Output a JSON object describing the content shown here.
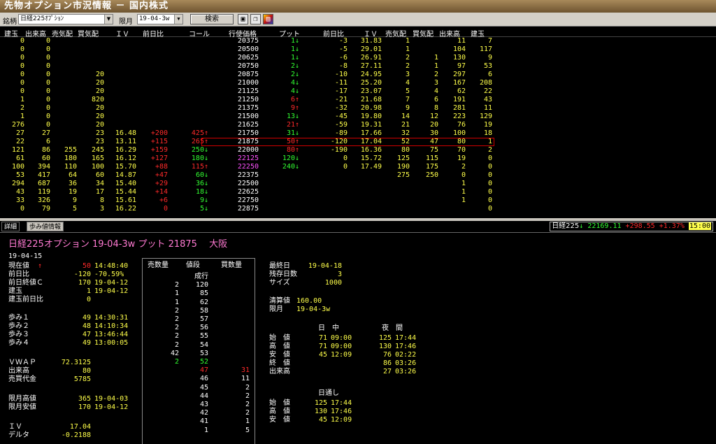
{
  "window": {
    "title": "先物オプション市況情報 － 国内株式"
  },
  "toolbar": {
    "brand_label": "銘柄",
    "brand_value": "日経225ｵﾌﾟｼｮﾝ",
    "month_label": "限月",
    "month_value": "19-04-3w",
    "search_label": "検索",
    "icons": [
      "save-icon",
      "copy-icon",
      "chart-icon"
    ]
  },
  "headers": {
    "call_oi": "建玉",
    "call_vol": "出来高",
    "call_bq": "売気配",
    "call_aq": "買気配",
    "call_iv": "ＩＶ",
    "call_chg": "前日比",
    "call_px": "コール",
    "strike": "行使価格",
    "put_px": "プット",
    "put_chg": "前日比",
    "put_iv": "ＩＶ",
    "put_bq": "売気配",
    "put_aq": "買気配",
    "put_vol": "出来高",
    "put_oi": "建玉"
  },
  "colors": {
    "bg": "#000000",
    "strike": "#ffffff",
    "atm_strike": "#ff52ff",
    "up": "#ff2a2a",
    "down": "#32ff32",
    "value": "#ffff4a",
    "highlight_border": "#d00000"
  },
  "selected_strike": "21875",
  "board": [
    {
      "c_oi": "0",
      "c_vol": "0",
      "c_bq": "",
      "c_aq": "",
      "c_iv": "",
      "c_chg": "",
      "c_px": "",
      "k": "20375",
      "p_px": "1↓",
      "p_chg": "-3",
      "p_iv": "31.83",
      "p_bq": "1",
      "p_aq": "",
      "p_vol": "11",
      "p_oi": "7"
    },
    {
      "c_oi": "0",
      "c_vol": "0",
      "c_bq": "",
      "c_aq": "",
      "c_iv": "",
      "c_chg": "",
      "c_px": "",
      "k": "20500",
      "p_px": "1↓",
      "p_chg": "-5",
      "p_iv": "29.01",
      "p_bq": "1",
      "p_aq": "",
      "p_vol": "104",
      "p_oi": "117"
    },
    {
      "c_oi": "0",
      "c_vol": "0",
      "c_bq": "",
      "c_aq": "",
      "c_iv": "",
      "c_chg": "",
      "c_px": "",
      "k": "20625",
      "p_px": "1↓",
      "p_chg": "-6",
      "p_iv": "26.91",
      "p_bq": "2",
      "p_aq": "1",
      "p_vol": "130",
      "p_oi": "9"
    },
    {
      "c_oi": "0",
      "c_vol": "0",
      "c_bq": "",
      "c_aq": "",
      "c_iv": "",
      "c_chg": "",
      "c_px": "",
      "k": "20750",
      "p_px": "2↓",
      "p_chg": "-8",
      "p_iv": "27.11",
      "p_bq": "2",
      "p_aq": "1",
      "p_vol": "97",
      "p_oi": "53"
    },
    {
      "c_oi": "0",
      "c_vol": "0",
      "c_bq": "",
      "c_aq": "20",
      "c_iv": "",
      "c_chg": "",
      "c_px": "",
      "k": "20875",
      "p_px": "2↓",
      "p_chg": "-10",
      "p_iv": "24.95",
      "p_bq": "3",
      "p_aq": "2",
      "p_vol": "297",
      "p_oi": "6"
    },
    {
      "c_oi": "0",
      "c_vol": "0",
      "c_bq": "",
      "c_aq": "20",
      "c_iv": "",
      "c_chg": "",
      "c_px": "",
      "k": "21000",
      "p_px": "4↓",
      "p_chg": "-11",
      "p_iv": "25.20",
      "p_bq": "4",
      "p_aq": "3",
      "p_vol": "167",
      "p_oi": "208"
    },
    {
      "c_oi": "0",
      "c_vol": "0",
      "c_bq": "",
      "c_aq": "20",
      "c_iv": "",
      "c_chg": "",
      "c_px": "",
      "k": "21125",
      "p_px": "4↓",
      "p_chg": "-17",
      "p_iv": "23.07",
      "p_bq": "5",
      "p_aq": "4",
      "p_vol": "62",
      "p_oi": "22"
    },
    {
      "c_oi": "1",
      "c_vol": "0",
      "c_bq": "",
      "c_aq": "820",
      "c_iv": "",
      "c_chg": "",
      "c_px": "",
      "k": "21250",
      "p_px": "6↑",
      "p_chg": "-21",
      "p_iv": "21.68",
      "p_bq": "7",
      "p_aq": "6",
      "p_vol": "191",
      "p_oi": "43"
    },
    {
      "c_oi": "2",
      "c_vol": "0",
      "c_bq": "",
      "c_aq": "20",
      "c_iv": "",
      "c_chg": "",
      "c_px": "",
      "k": "21375",
      "p_px": "9↑",
      "p_chg": "-32",
      "p_iv": "20.98",
      "p_bq": "9",
      "p_aq": "8",
      "p_vol": "281",
      "p_oi": "11"
    },
    {
      "c_oi": "1",
      "c_vol": "0",
      "c_bq": "",
      "c_aq": "20",
      "c_iv": "",
      "c_chg": "",
      "c_px": "",
      "k": "21500",
      "p_px": "13↓",
      "p_chg": "-45",
      "p_iv": "19.80",
      "p_bq": "14",
      "p_aq": "12",
      "p_vol": "223",
      "p_oi": "129"
    },
    {
      "c_oi": "276",
      "c_vol": "0",
      "c_bq": "",
      "c_aq": "20",
      "c_iv": "",
      "c_chg": "",
      "c_px": "",
      "k": "21625",
      "p_px": "21↑",
      "p_chg": "-59",
      "p_iv": "19.31",
      "p_bq": "21",
      "p_aq": "20",
      "p_vol": "76",
      "p_oi": "19"
    },
    {
      "c_oi": "27",
      "c_vol": "27",
      "c_bq": "",
      "c_aq": "23",
      "c_iv": "16.48",
      "c_chg": "+200",
      "c_px": "425↑",
      "k": "21750",
      "p_px": "31↓",
      "p_chg": "-89",
      "p_iv": "17.66",
      "p_bq": "32",
      "p_aq": "30",
      "p_vol": "100",
      "p_oi": "18"
    },
    {
      "c_oi": "22",
      "c_vol": "6",
      "c_bq": "",
      "c_aq": "23",
      "c_iv": "13.11",
      "c_chg": "+115",
      "c_px": "265↑",
      "k": "21875",
      "p_px": "50↑",
      "p_chg": "-120",
      "p_iv": "17.04",
      "p_bq": "52",
      "p_aq": "47",
      "p_vol": "80",
      "p_oi": "1"
    },
    {
      "c_oi": "121",
      "c_vol": "86",
      "c_bq": "255",
      "c_aq": "245",
      "c_iv": "16.29",
      "c_chg": "+159",
      "c_px": "250↓",
      "k": "22000",
      "p_px": "80↑",
      "p_chg": "-190",
      "p_iv": "16.36",
      "p_bq": "80",
      "p_aq": "75",
      "p_vol": "70",
      "p_oi": "2"
    },
    {
      "c_oi": "61",
      "c_vol": "60",
      "c_bq": "180",
      "c_aq": "165",
      "c_iv": "16.12",
      "c_chg": "+127",
      "c_px": "180↓",
      "k": "22125",
      "p_px": "120↓",
      "p_chg": "0",
      "p_iv": "15.72",
      "p_bq": "125",
      "p_aq": "115",
      "p_vol": "19",
      "p_oi": "0"
    },
    {
      "c_oi": "100",
      "c_vol": "394",
      "c_bq": "110",
      "c_aq": "100",
      "c_iv": "15.70",
      "c_chg": "+88",
      "c_px": "115↑",
      "k": "22250",
      "p_px": "240↓",
      "p_chg": "0",
      "p_iv": "17.49",
      "p_bq": "190",
      "p_aq": "175",
      "p_vol": "2",
      "p_oi": "0"
    },
    {
      "c_oi": "53",
      "c_vol": "417",
      "c_bq": "64",
      "c_aq": "60",
      "c_iv": "14.87",
      "c_chg": "+47",
      "c_px": "60↓",
      "k": "22375",
      "p_px": "",
      "p_chg": "",
      "p_iv": "",
      "p_bq": "275",
      "p_aq": "250",
      "p_vol": "0",
      "p_oi": "0"
    },
    {
      "c_oi": "294",
      "c_vol": "687",
      "c_bq": "36",
      "c_aq": "34",
      "c_iv": "15.40",
      "c_chg": "+29",
      "c_px": "36↓",
      "k": "22500",
      "p_px": "",
      "p_chg": "",
      "p_iv": "",
      "p_bq": "",
      "p_aq": "",
      "p_vol": "1",
      "p_oi": "0"
    },
    {
      "c_oi": "43",
      "c_vol": "119",
      "c_bq": "19",
      "c_aq": "17",
      "c_iv": "15.44",
      "c_chg": "+14",
      "c_px": "18↓",
      "k": "22625",
      "p_px": "",
      "p_chg": "",
      "p_iv": "",
      "p_bq": "",
      "p_aq": "",
      "p_vol": "1",
      "p_oi": "0"
    },
    {
      "c_oi": "33",
      "c_vol": "326",
      "c_bq": "9",
      "c_aq": "8",
      "c_iv": "15.61",
      "c_chg": "+6",
      "c_px": "9↓",
      "k": "22750",
      "p_px": "",
      "p_chg": "",
      "p_iv": "",
      "p_bq": "",
      "p_aq": "",
      "p_vol": "1",
      "p_oi": "0"
    },
    {
      "c_oi": "0",
      "c_vol": "79",
      "c_bq": "5",
      "c_aq": "3",
      "c_iv": "16.22",
      "c_chg": "0",
      "c_px": "5↓",
      "k": "22875",
      "p_px": "",
      "p_chg": "",
      "p_iv": "",
      "p_bq": "",
      "p_aq": "",
      "p_vol": "",
      "p_oi": "0"
    }
  ],
  "detail_tabs": {
    "detail": "詳細",
    "ticks": "歩み値情報"
  },
  "ticker": {
    "name": "日経225",
    "arrow": "↓",
    "price": "22169.11",
    "change": "+298.55",
    "pct": "+1.37%",
    "time": "15:00"
  },
  "detail": {
    "title": "日経225オプション 19-04-3w プット 21875　 大阪",
    "date": "19-04-15",
    "left": [
      {
        "label": "現在値",
        "mark": "↑",
        "v1": "50",
        "v2": "14:48:40"
      },
      {
        "label": "前日比",
        "v1": "-120",
        "v2": "-70.59%"
      },
      {
        "label": "前日終値Ｃ",
        "v1": "170",
        "v2": "19-04-12"
      },
      {
        "label": "建玉",
        "v1": "1",
        "v2": "19-04-12"
      },
      {
        "label": "建玉前日比",
        "v1": "0",
        "v2": ""
      },
      {
        "label": "歩み１",
        "v1": "49",
        "v2": "14:30:31"
      },
      {
        "label": "歩み２",
        "v1": "48",
        "v2": "14:10:34"
      },
      {
        "label": "歩み３",
        "v1": "47",
        "v2": "13:46:44"
      },
      {
        "label": "歩み４",
        "v1": "49",
        "v2": "13:00:05"
      },
      {
        "label": "ＶＷＡＰ",
        "v1": "72.3125",
        "v2": ""
      },
      {
        "label": "出来高",
        "v1": "80",
        "v2": ""
      },
      {
        "label": "売買代金",
        "v1": "5785",
        "v2": ""
      },
      {
        "label": "限月高値",
        "v1": "365",
        "v2": "19-04-03"
      },
      {
        "label": "限月安値",
        "v1": "170",
        "v2": "19-04-12"
      },
      {
        "label": "ＩＶ",
        "v1": "17.04",
        "v2": ""
      },
      {
        "label": "デルタ",
        "v1": "-0.2188",
        "v2": ""
      }
    ],
    "ladder_headers": {
      "sell": "売数量",
      "price": "値段",
      "buy": "買数量"
    },
    "ladder": [
      {
        "s": "",
        "p": "成行",
        "b": ""
      },
      {
        "s": "2",
        "p": "120",
        "b": ""
      },
      {
        "s": "1",
        "p": "85",
        "b": ""
      },
      {
        "s": "1",
        "p": "62",
        "b": ""
      },
      {
        "s": "2",
        "p": "58",
        "b": ""
      },
      {
        "s": "2",
        "p": "57",
        "b": ""
      },
      {
        "s": "2",
        "p": "56",
        "b": ""
      },
      {
        "s": "2",
        "p": "55",
        "b": ""
      },
      {
        "s": "2",
        "p": "54",
        "b": ""
      },
      {
        "s": "42",
        "p": "53",
        "b": ""
      },
      {
        "s": "2",
        "p": "52",
        "b": ""
      },
      {
        "s": "",
        "p": "47",
        "b": "31"
      },
      {
        "s": "",
        "p": "46",
        "b": "11"
      },
      {
        "s": "",
        "p": "45",
        "b": "2"
      },
      {
        "s": "",
        "p": "44",
        "b": "2"
      },
      {
        "s": "",
        "p": "43",
        "b": "2"
      },
      {
        "s": "",
        "p": "42",
        "b": "2"
      },
      {
        "s": "",
        "p": "41",
        "b": "1"
      },
      {
        "s": "",
        "p": "1",
        "b": "5"
      }
    ],
    "info": [
      {
        "label": "最終日",
        "value": "19-04-18"
      },
      {
        "label": "残存日数",
        "value": "3"
      },
      {
        "label": "サイズ",
        "value": "1000"
      }
    ],
    "settle": [
      {
        "label": "清算値",
        "value": "160.00"
      },
      {
        "label": "限月",
        "value": "19-04-3w"
      }
    ],
    "session_headers": {
      "day": "日　中",
      "night": "夜　間"
    },
    "session": [
      {
        "label": "始　値",
        "d1": "71",
        "d2": "09:00",
        "n1": "125",
        "n2": "17:44"
      },
      {
        "label": "高　値",
        "d1": "71",
        "d2": "09:00",
        "n1": "130",
        "n2": "17:46"
      },
      {
        "label": "安　値",
        "d1": "45",
        "d2": "12:09",
        "n1": "76",
        "n2": "02:22"
      },
      {
        "label": "終　値",
        "d1": "",
        "d2": "",
        "n1": "86",
        "n2": "03:26"
      },
      {
        "label": "出来高",
        "d1": "",
        "d2": "",
        "n1": "27",
        "n2": "03:26"
      }
    ],
    "through_header": "日通し",
    "through": [
      {
        "label": "始　値",
        "v1": "125",
        "v2": "17:44"
      },
      {
        "label": "高　値",
        "v1": "130",
        "v2": "17:46"
      },
      {
        "label": "安　値",
        "v1": "45",
        "v2": "12:09"
      }
    ]
  }
}
